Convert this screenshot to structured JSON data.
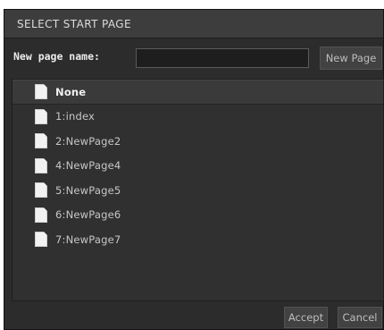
{
  "dialog": {
    "title": "SELECT START PAGE",
    "new_page_label": "New page name:",
    "new_page_input": {
      "value": "",
      "placeholder": ""
    },
    "new_page_button": "New Page",
    "pages": [
      {
        "label": "None",
        "selected": true
      },
      {
        "label": "1:index",
        "selected": false
      },
      {
        "label": "2:NewPage2",
        "selected": false
      },
      {
        "label": "4:NewPage4",
        "selected": false
      },
      {
        "label": "5:NewPage5",
        "selected": false
      },
      {
        "label": "6:NewPage6",
        "selected": false
      },
      {
        "label": "7:NewPage7",
        "selected": false
      }
    ],
    "accept_button": "Accept",
    "cancel_button": "Cancel"
  },
  "colors": {
    "background": "#2c2c2c",
    "titlebar": "#3d3d3d",
    "list_background": "#303030",
    "selected_row": "#3a3a3a",
    "text": "#c6c6c6",
    "page_icon": "#f2f2f2"
  },
  "icons": {
    "page": "page-icon"
  }
}
